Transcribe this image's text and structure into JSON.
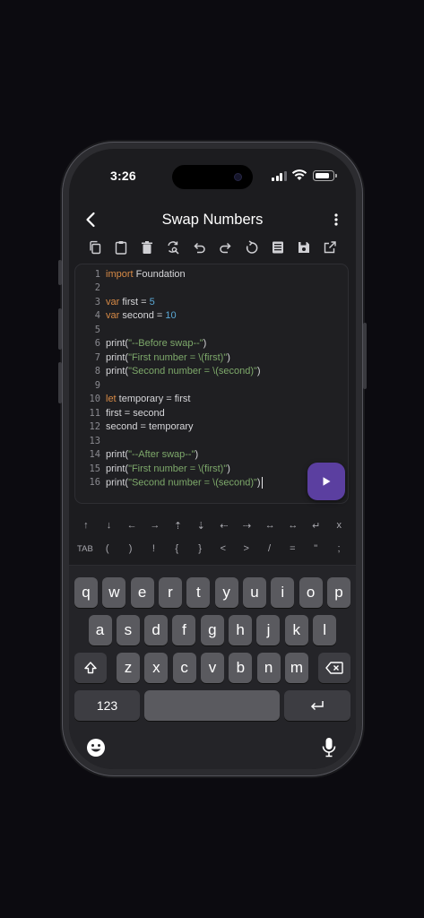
{
  "status_bar": {
    "time": "3:26"
  },
  "nav": {
    "title": "Swap Numbers"
  },
  "toolbar": {
    "tools": [
      {
        "name": "copy-icon"
      },
      {
        "name": "clipboard-icon"
      },
      {
        "name": "trash-icon"
      },
      {
        "name": "find-replace-icon"
      },
      {
        "name": "undo-icon"
      },
      {
        "name": "redo-icon"
      },
      {
        "name": "reset-icon"
      },
      {
        "name": "document-icon"
      },
      {
        "name": "save-icon"
      },
      {
        "name": "share-icon"
      }
    ]
  },
  "editor": {
    "lines": [
      {
        "n": "1",
        "segments": [
          {
            "t": "import",
            "c": "kw"
          },
          {
            "t": " Foundation",
            "c": ""
          }
        ]
      },
      {
        "n": "2",
        "segments": []
      },
      {
        "n": "3",
        "segments": [
          {
            "t": "var",
            "c": "kw"
          },
          {
            "t": " first = ",
            "c": ""
          },
          {
            "t": "5",
            "c": "num"
          }
        ]
      },
      {
        "n": "4",
        "segments": [
          {
            "t": "var",
            "c": "kw"
          },
          {
            "t": " second = ",
            "c": ""
          },
          {
            "t": "10",
            "c": "num"
          }
        ]
      },
      {
        "n": "5",
        "segments": []
      },
      {
        "n": "6",
        "segments": [
          {
            "t": "print(",
            "c": ""
          },
          {
            "t": "\"--Before swap--\"",
            "c": "str"
          },
          {
            "t": ")",
            "c": ""
          }
        ]
      },
      {
        "n": "7",
        "segments": [
          {
            "t": "print(",
            "c": ""
          },
          {
            "t": "\"First number = \\(first)\"",
            "c": "str"
          },
          {
            "t": ")",
            "c": ""
          }
        ]
      },
      {
        "n": "8",
        "segments": [
          {
            "t": "print(",
            "c": ""
          },
          {
            "t": "\"Second number = \\(second)\"",
            "c": "str"
          },
          {
            "t": ")",
            "c": ""
          }
        ]
      },
      {
        "n": "9",
        "segments": []
      },
      {
        "n": "10",
        "segments": [
          {
            "t": "let",
            "c": "kw"
          },
          {
            "t": " temporary = first",
            "c": ""
          }
        ]
      },
      {
        "n": "11",
        "segments": [
          {
            "t": "first = second",
            "c": ""
          }
        ]
      },
      {
        "n": "12",
        "segments": [
          {
            "t": "second = temporary",
            "c": ""
          }
        ]
      },
      {
        "n": "13",
        "segments": []
      },
      {
        "n": "14",
        "segments": [
          {
            "t": "print(",
            "c": ""
          },
          {
            "t": "\"--After swap--\"",
            "c": "str"
          },
          {
            "t": ")",
            "c": ""
          }
        ]
      },
      {
        "n": "15",
        "segments": [
          {
            "t": "print(",
            "c": ""
          },
          {
            "t": "\"First number = \\(first)\"",
            "c": "str"
          },
          {
            "t": ")",
            "c": ""
          }
        ]
      },
      {
        "n": "16",
        "segments": [
          {
            "t": "print(",
            "c": ""
          },
          {
            "t": "\"Second number = \\(second)\"",
            "c": "str"
          },
          {
            "t": ")",
            "c": ""
          }
        ],
        "cursor": true
      }
    ]
  },
  "accessory": {
    "row1": [
      "↑",
      "↓",
      "←",
      "→",
      "⇡",
      "⇣",
      "⇠",
      "⇢",
      "↔",
      "↔",
      "↵",
      "x"
    ],
    "row2": [
      "TAB",
      "(",
      ")",
      "!",
      "{",
      "}",
      "<",
      ">",
      "/",
      "=",
      "\"",
      ";"
    ]
  },
  "keyboard": {
    "row1": [
      "q",
      "w",
      "e",
      "r",
      "t",
      "y",
      "u",
      "i",
      "o",
      "p"
    ],
    "row2": [
      "a",
      "s",
      "d",
      "f",
      "g",
      "h",
      "j",
      "k",
      "l"
    ],
    "row3": [
      "z",
      "x",
      "c",
      "v",
      "b",
      "n",
      "m"
    ],
    "numbers_key": "123"
  },
  "colors": {
    "keyword": "#d78a46",
    "number": "#5aa7d4",
    "string": "#7da86a",
    "run_button": "#5b3fa0"
  }
}
